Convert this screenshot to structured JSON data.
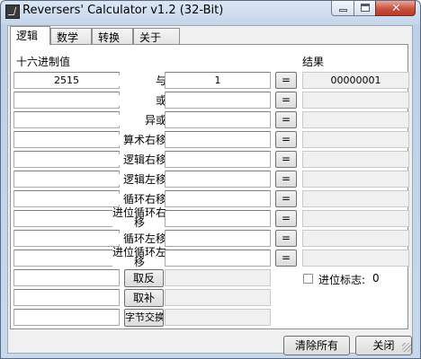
{
  "window": {
    "title": "Reversers' Calculator v1.2 (32-Bit)",
    "close_glyph": "✕"
  },
  "tabs": [
    {
      "label": "逻辑",
      "active": true
    },
    {
      "label": "数学",
      "active": false
    },
    {
      "label": "转换",
      "active": false
    },
    {
      "label": "关于",
      "active": false
    }
  ],
  "labels": {
    "hex_value": "十六进制值",
    "result": "结果",
    "equals": "="
  },
  "rows": [
    {
      "op": "与",
      "a": "2515",
      "b": "1",
      "result": "00000001"
    },
    {
      "op": "或",
      "a": "",
      "b": "",
      "result": ""
    },
    {
      "op": "异或",
      "a": "",
      "b": "",
      "result": ""
    },
    {
      "op": "算术右移",
      "a": "",
      "b": "",
      "result": ""
    },
    {
      "op": "逻辑右移",
      "a": "",
      "b": "",
      "result": ""
    },
    {
      "op": "逻辑左移",
      "a": "",
      "b": "",
      "result": ""
    },
    {
      "op": "循环右移",
      "a": "",
      "b": "",
      "result": ""
    },
    {
      "op": "进位循环右移",
      "a": "",
      "b": "",
      "result": ""
    },
    {
      "op": "循环左移",
      "a": "",
      "b": "",
      "result": ""
    },
    {
      "op": "进位循环左移",
      "a": "",
      "b": "",
      "result": ""
    }
  ],
  "unary": [
    {
      "button": "取反",
      "input": "",
      "result": ""
    },
    {
      "button": "取补",
      "input": "",
      "result": ""
    },
    {
      "button": "字节交换",
      "input": "",
      "result": ""
    }
  ],
  "carry": {
    "label": "进位标志:",
    "value": "0",
    "checked": false
  },
  "footer": {
    "clear_all": "清除所有",
    "close": "关闭"
  }
}
